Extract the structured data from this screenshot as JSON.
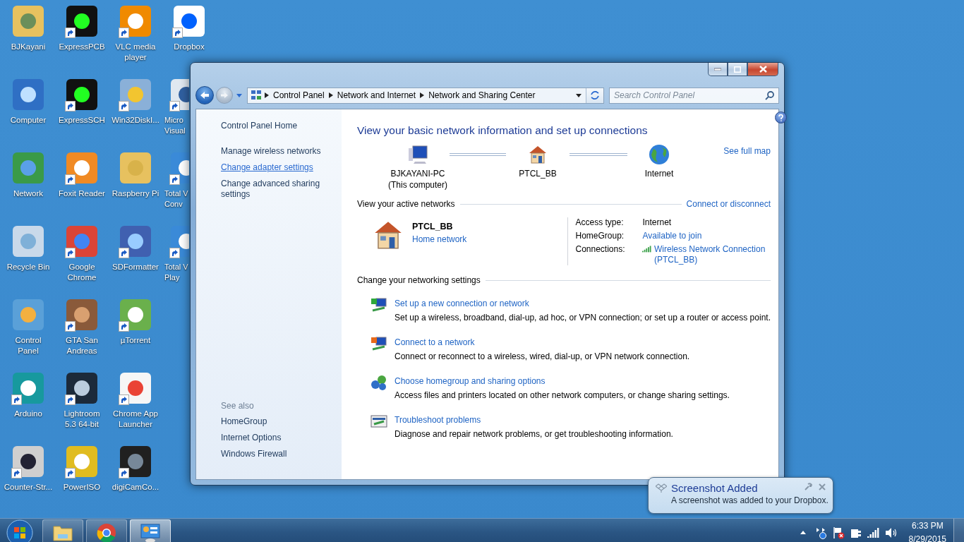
{
  "desktop_icons": [
    {
      "label": "BJKayani",
      "shortcut": false
    },
    {
      "label": "Computer",
      "shortcut": false
    },
    {
      "label": "Network",
      "shortcut": false
    },
    {
      "label": "Recycle Bin",
      "shortcut": false
    },
    {
      "label": "Control\nPanel",
      "shortcut": false
    },
    {
      "label": "Arduino",
      "shortcut": true
    },
    {
      "label": "Counter-Str...",
      "shortcut": true
    },
    {
      "label": "ExpressPCB",
      "shortcut": true
    },
    {
      "label": "ExpressSCH",
      "shortcut": true
    },
    {
      "label": "Foxit Reader",
      "shortcut": true
    },
    {
      "label": "Google\nChrome",
      "shortcut": true
    },
    {
      "label": "GTA San\nAndreas",
      "shortcut": true
    },
    {
      "label": "Lightroom\n5.3 64-bit",
      "shortcut": true
    },
    {
      "label": "PowerISO",
      "shortcut": true
    },
    {
      "label": "VLC media\nplayer",
      "shortcut": true
    },
    {
      "label": "Win32DiskI...",
      "shortcut": true
    },
    {
      "label": "Raspberry Pi",
      "shortcut": false
    },
    {
      "label": "SDFormatter",
      "shortcut": true
    },
    {
      "label": "µTorrent",
      "shortcut": true
    },
    {
      "label": "Chrome App\nLauncher",
      "shortcut": true
    },
    {
      "label": "digiCamCo...",
      "shortcut": true
    },
    {
      "label": "Dropbox",
      "shortcut": true
    },
    {
      "label": "Micro\nVisual",
      "shortcut": true
    },
    {
      "label": "Total V\nConv",
      "shortcut": true
    },
    {
      "label": "Total V\nPlay",
      "shortcut": true
    }
  ],
  "window": {
    "breadcrumb": [
      "Control Panel",
      "Network and Internet",
      "Network and Sharing Center"
    ],
    "search": {
      "placeholder": "Search Control Panel"
    },
    "sidebar": {
      "home": "Control Panel Home",
      "tasks": [
        {
          "label": "Manage wireless networks",
          "hovered": false
        },
        {
          "label": "Change adapter settings",
          "hovered": true
        },
        {
          "label": "Change advanced sharing settings",
          "hovered": false
        }
      ],
      "see_also_title": "See also",
      "see_also": [
        "HomeGroup",
        "Internet Options",
        "Windows Firewall"
      ]
    },
    "heading": "View your basic network information and set up connections",
    "see_full_map": "See full map",
    "map": [
      {
        "label": "BJKAYANI-PC",
        "sublabel": "(This computer)"
      },
      {
        "label": "PTCL_BB"
      },
      {
        "label": "Internet"
      }
    ],
    "active_networks": {
      "title": "View your active networks",
      "link": "Connect or disconnect",
      "name": "PTCL_BB",
      "type": "Home network",
      "properties": [
        {
          "key": "Access type:",
          "value": "Internet",
          "kind": "text"
        },
        {
          "key": "HomeGroup:",
          "value": "Available to join",
          "kind": "link"
        },
        {
          "key": "Connections:",
          "value": "Wireless Network Connection (PTCL_BB)",
          "kind": "connection"
        }
      ]
    },
    "settings": {
      "title": "Change your networking settings",
      "items": [
        {
          "title": "Set up a new connection or network",
          "description": "Set up a wireless, broadband, dial-up, ad hoc, or VPN connection; or set up a router or access point."
        },
        {
          "title": "Connect to a network",
          "description": "Connect or reconnect to a wireless, wired, dial-up, or VPN network connection."
        },
        {
          "title": "Choose homegroup and sharing options",
          "description": "Access files and printers located on other network computers, or change sharing settings."
        },
        {
          "title": "Troubleshoot problems",
          "description": "Diagnose and repair network problems, or get troubleshooting information."
        }
      ]
    }
  },
  "notification": {
    "title": "Screenshot Added",
    "message": "A screenshot was added to your Dropbox."
  },
  "taskbar": {
    "buttons": [
      {
        "selected": false
      },
      {
        "selected": false
      },
      {
        "selected": true
      }
    ],
    "clock": {
      "time": "6:33 PM",
      "date": "8/29/2015"
    }
  }
}
